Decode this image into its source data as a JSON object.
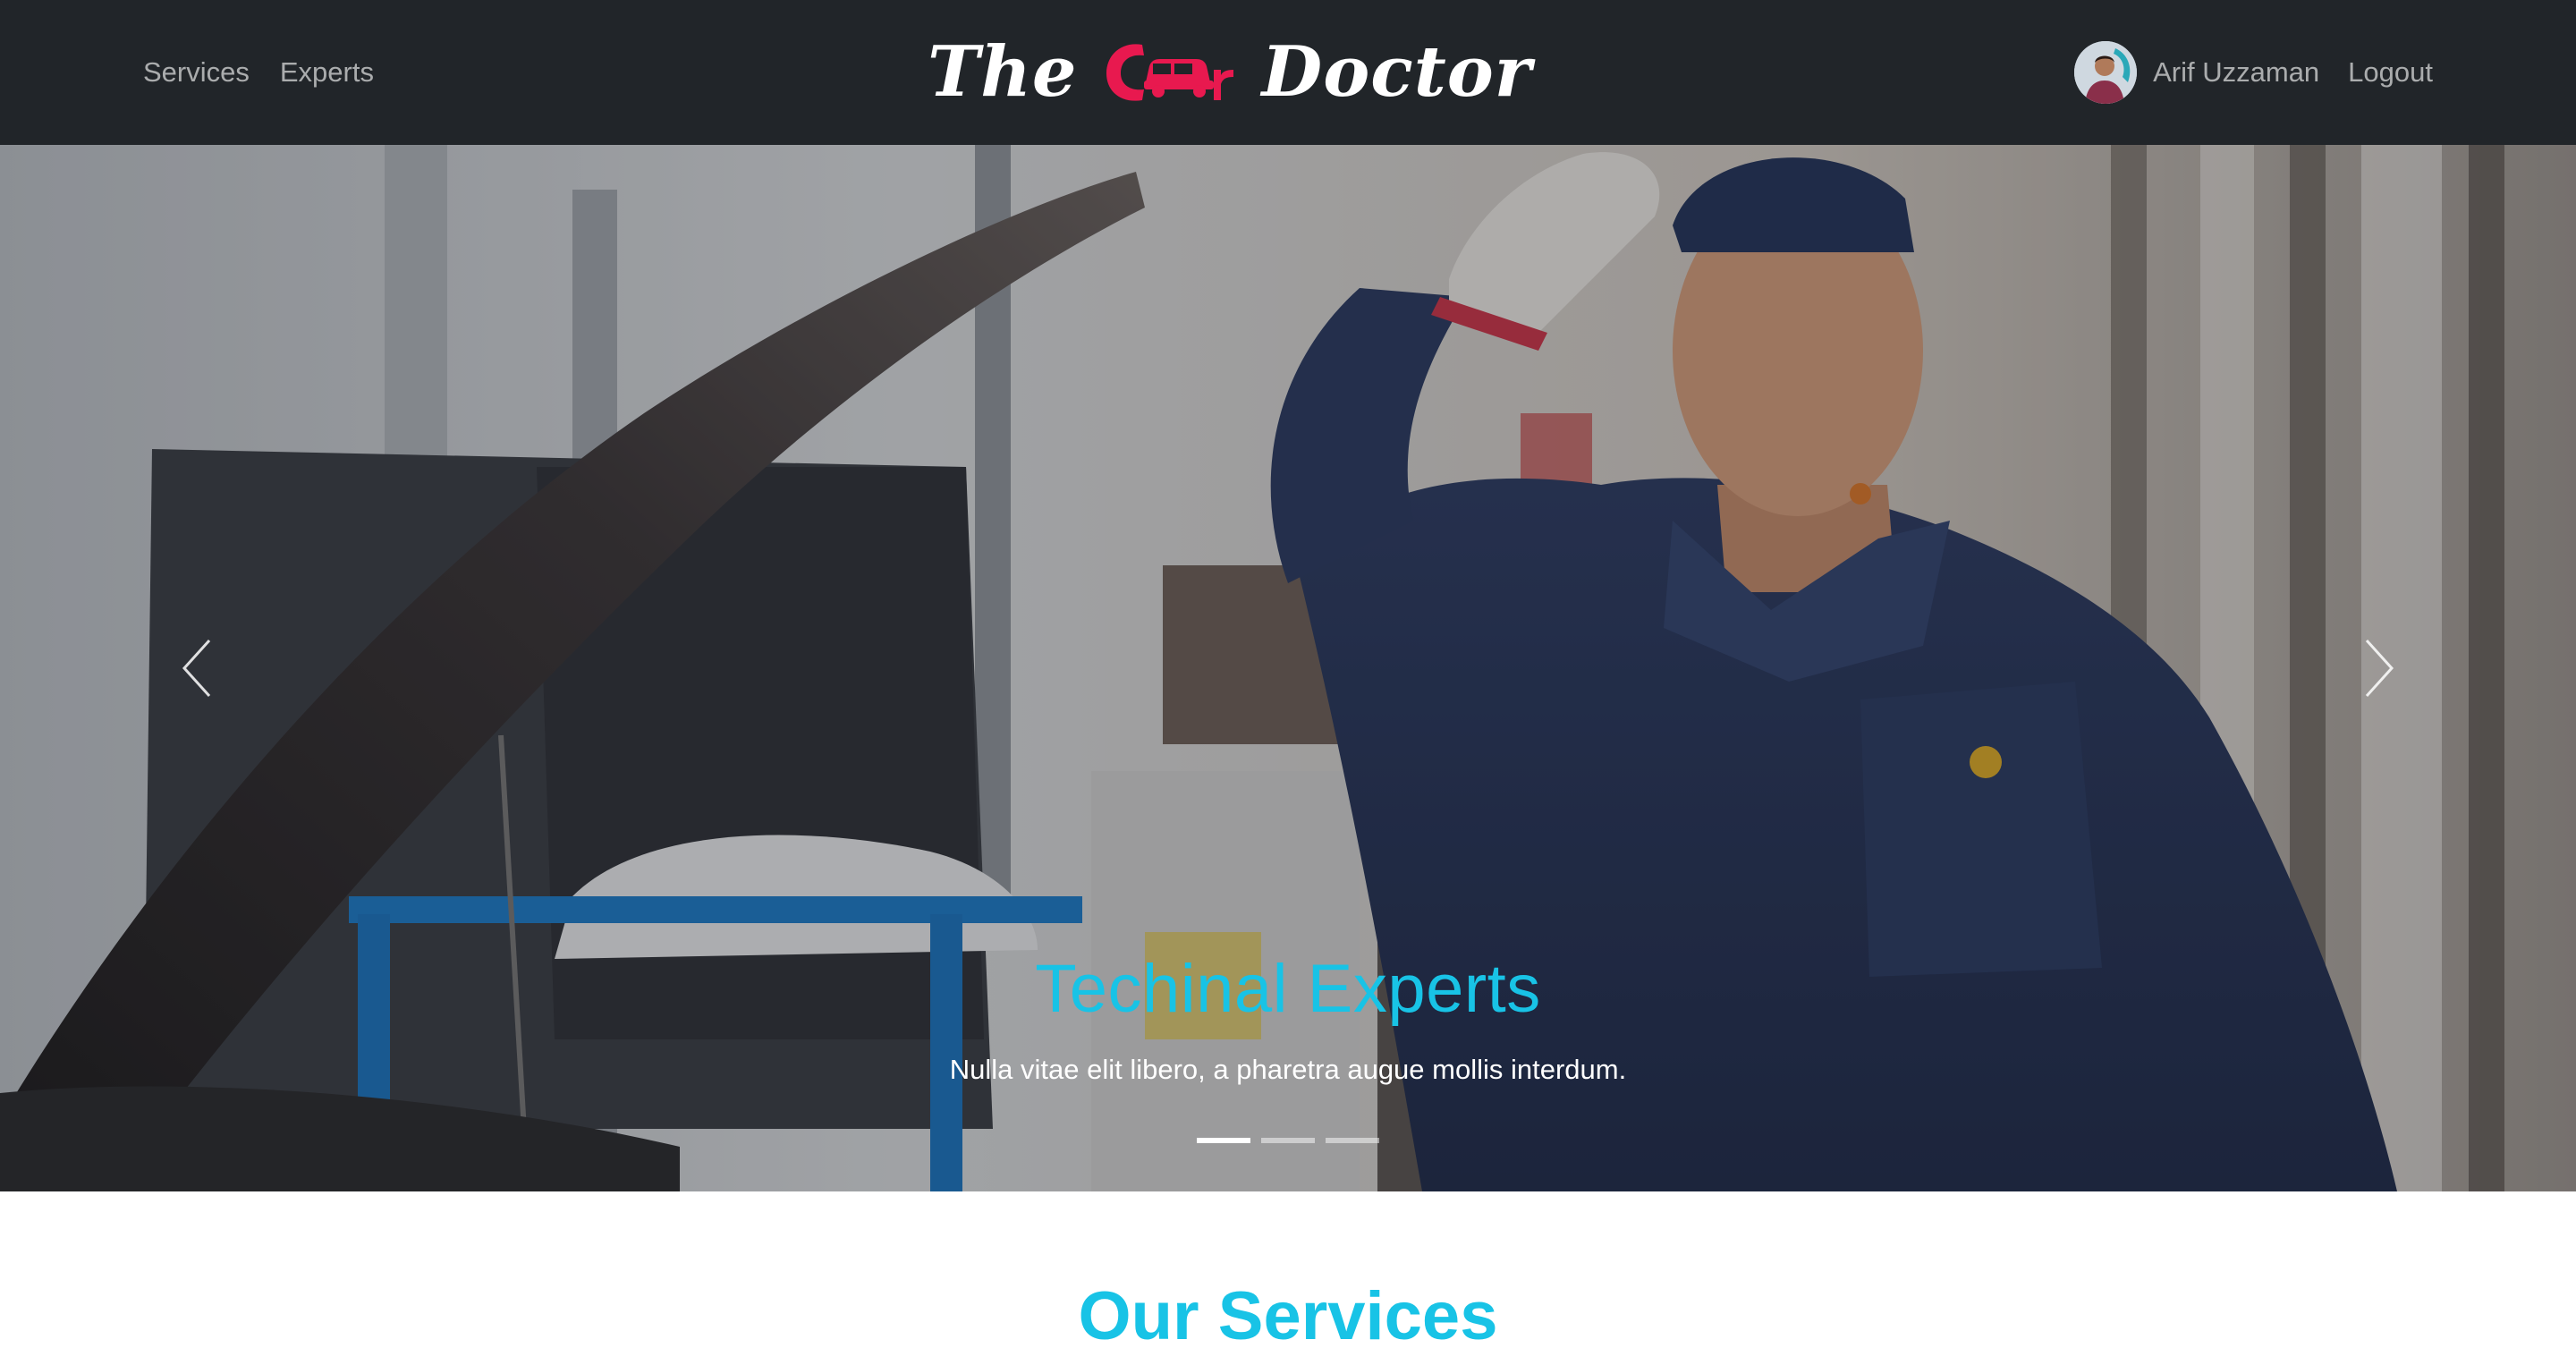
{
  "navbar": {
    "links": [
      {
        "label": "Services"
      },
      {
        "label": "Experts"
      }
    ],
    "brand": {
      "word1": "The",
      "word2": "Car",
      "word3": "Doctor",
      "accent_color": "#e8194f"
    },
    "user": {
      "name": "Arif Uzzaman",
      "avatar_icon": "user-avatar"
    },
    "logout_label": "Logout",
    "background": "#212529"
  },
  "hero": {
    "slide_title": "Techinal Experts",
    "slide_text": "Nulla vitae elit libero, a pharetra augue mollis interdum.",
    "title_color": "#18c3e6",
    "prev_icon": "chevron-left-icon",
    "next_icon": "chevron-right-icon",
    "indicators": [
      {
        "active": true
      },
      {
        "active": false
      },
      {
        "active": false
      }
    ]
  },
  "services": {
    "title": "Our Services",
    "title_color": "#18c3e6"
  }
}
